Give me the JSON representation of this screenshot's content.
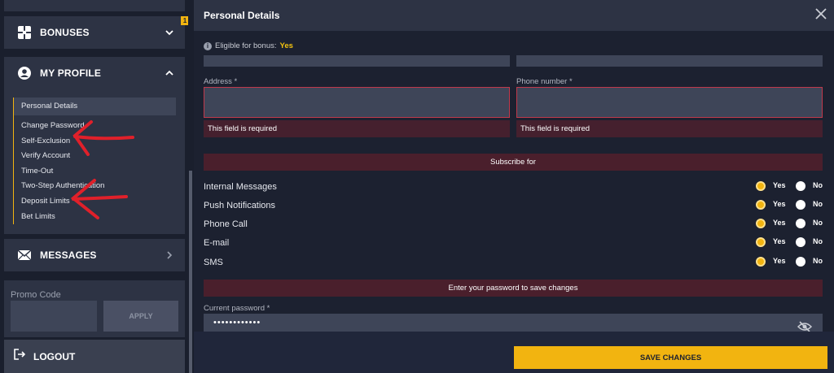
{
  "sidebar": {
    "bonuses_label": "BONUSES",
    "bonuses_badge": "1",
    "profile_label": "MY PROFILE",
    "submenu": [
      {
        "label": "Personal Details"
      },
      {
        "label": "Change Password"
      },
      {
        "label": "Self-Exclusion"
      },
      {
        "label": "Verify Account"
      },
      {
        "label": "Time-Out"
      },
      {
        "label": "Two-Step Authentication"
      },
      {
        "label": "Deposit Limits"
      },
      {
        "label": "Bet Limits"
      }
    ],
    "messages_label": "MESSAGES",
    "promo_label": "Promo Code",
    "promo_value": "",
    "apply_label": "APPLY",
    "logout_label": "LOGOUT"
  },
  "modal": {
    "title": "Personal Details",
    "eligible_label": "Eligible for bonus:",
    "eligible_value": "Yes",
    "address_label": "Address *",
    "address_value": "",
    "address_error": "This field is required",
    "phone_label": "Phone number *",
    "phone_value": "",
    "phone_error": "This field is required",
    "subscribe_title": "Subscribe for",
    "subscriptions": [
      {
        "name": "Internal Messages",
        "yes": "Yes",
        "no": "No",
        "selected": "yes"
      },
      {
        "name": "Push Notifications",
        "yes": "Yes",
        "no": "No",
        "selected": "yes"
      },
      {
        "name": "Phone Call",
        "yes": "Yes",
        "no": "No",
        "selected": "yes"
      },
      {
        "name": "E-mail",
        "yes": "Yes",
        "no": "No",
        "selected": "yes"
      },
      {
        "name": "SMS",
        "yes": "Yes",
        "no": "No",
        "selected": "yes"
      }
    ],
    "password_bar": "Enter your password to save changes",
    "current_password_label": "Current password *",
    "current_password_value": "••••••••••••",
    "save_label": "SAVE CHANGES"
  },
  "colors": {
    "accent": "#f2b410",
    "error_border": "#c0394b",
    "annotation_arrow": "#e0202a"
  },
  "icons": {
    "bonuses": "gift-icon",
    "profile": "user-circle-icon",
    "messages": "envelope-icon",
    "logout": "logout-icon",
    "close": "close-icon",
    "info": "info-icon",
    "eye": "eye-slash-icon"
  }
}
